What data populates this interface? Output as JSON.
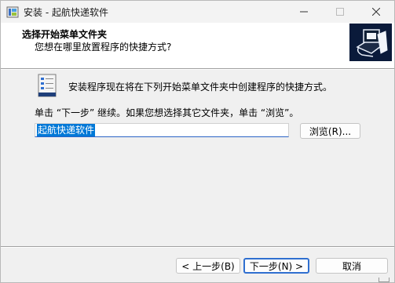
{
  "window": {
    "title": "安装 - 起航快递软件",
    "controls": {
      "minimize": "minimize-icon",
      "maximize": "maximize-icon",
      "close": "close-icon"
    }
  },
  "header": {
    "title": "选择开始菜单文件夹",
    "subtitle": "您想在哪里放置程序的快捷方式?"
  },
  "body": {
    "info_text": "安装程序现在将在下列开始菜单文件夹中创建程序的快捷方式。",
    "hint_text": "单击 “下一步” 继续。如果您想选择其它文件夹，单击 “浏览”。",
    "folder_value": "起航快递软件",
    "browse_label": "浏览(R)..."
  },
  "footer": {
    "back_label": "< 上一步(B)",
    "next_label": "下一步(N) >",
    "cancel_label": "取消"
  },
  "colors": {
    "accent": "#2f6fd0",
    "selection": "#0078d7",
    "window_bg": "#f0f0f0",
    "header_bg": "#ffffff"
  }
}
